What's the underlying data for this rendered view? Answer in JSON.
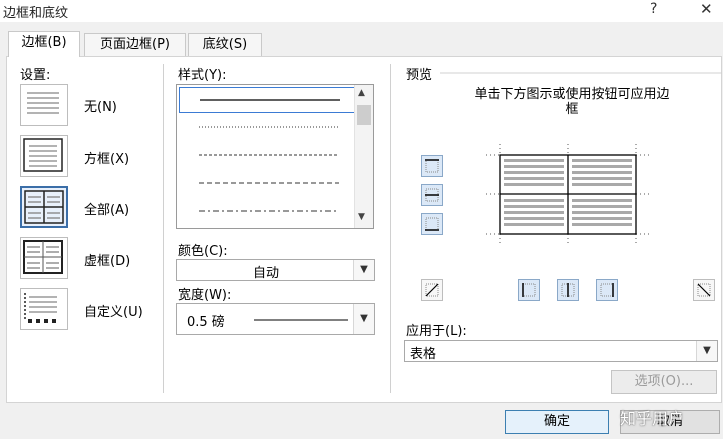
{
  "dialog": {
    "title": "边框和底纹",
    "help": "?",
    "close": "✕"
  },
  "tabs": [
    {
      "label": "边框(B)",
      "active": true
    },
    {
      "label": "页面边框(P)",
      "active": false
    },
    {
      "label": "底纹(S)",
      "active": false
    }
  ],
  "settings": {
    "label": "设置:",
    "items": [
      {
        "label": "无(N)",
        "icon": "setting-none-icon"
      },
      {
        "label": "方框(X)",
        "icon": "setting-box-icon"
      },
      {
        "label": "全部(A)",
        "icon": "setting-all-icon",
        "selected": true
      },
      {
        "label": "虚框(D)",
        "icon": "setting-grid-icon"
      },
      {
        "label": "自定义(U)",
        "icon": "setting-custom-icon"
      }
    ]
  },
  "style": {
    "label": "样式(Y):",
    "selected_index": 0
  },
  "color": {
    "label": "颜色(C):",
    "value": "自动"
  },
  "width": {
    "label": "宽度(W):",
    "value": "0.5 磅"
  },
  "preview": {
    "label": "预览",
    "hint_line1": "单击下方图示或使用按钮可应用边",
    "hint_line2": "框"
  },
  "apply_to": {
    "label": "应用于(L):",
    "value": "表格"
  },
  "buttons": {
    "options": "选项(O)...",
    "ok": "确定",
    "cancel": "取消"
  },
  "watermark": "知乎用户",
  "colors": {
    "accent": "#3b6ea8",
    "selection": "#3b7bd4"
  }
}
